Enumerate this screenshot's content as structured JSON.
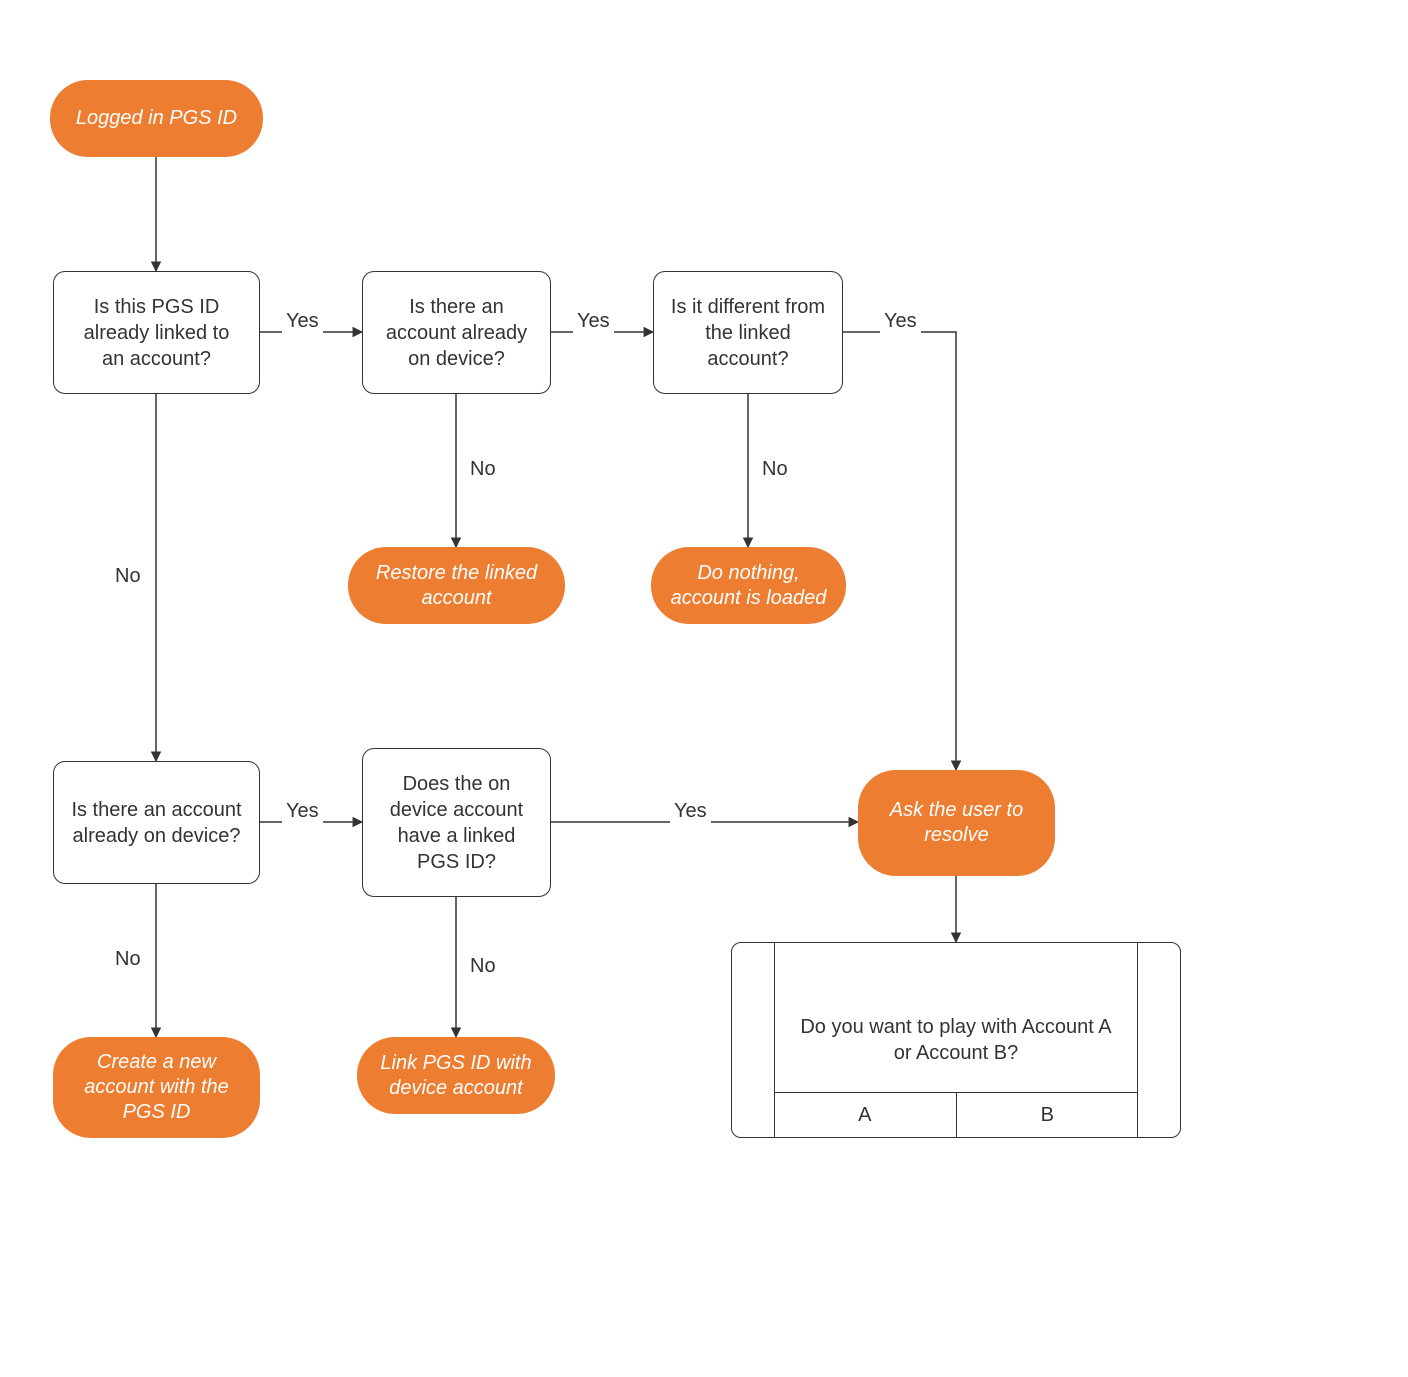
{
  "colors": {
    "accent": "#ed7d31",
    "line": "#333333"
  },
  "nodes": {
    "start": "Logged in PGS ID",
    "q1": "Is this PGS ID already linked to an account?",
    "q2": "Is there an account already on device?",
    "q3": "Is it different from the linked account?",
    "restore": "Restore the linked account",
    "donothing": "Do nothing, account is loaded",
    "q4": "Is there an account already on device?",
    "q5": "Does the on device account have a linked PGS ID?",
    "create": "Create a new account with the PGS  ID",
    "link": "Link PGS ID with device account",
    "resolve": "Ask the user to resolve",
    "dialog_prompt": "Do you want to play with Account A or Account B?",
    "dialog_a": "A",
    "dialog_b": "B"
  },
  "edges": {
    "yes": "Yes",
    "no": "No"
  }
}
